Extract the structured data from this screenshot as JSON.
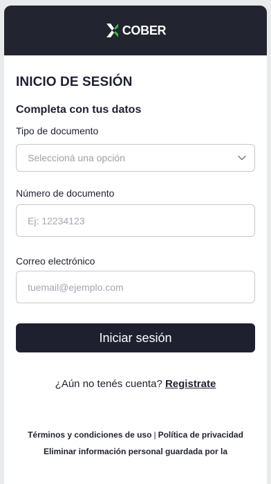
{
  "header": {
    "brand": "COBER"
  },
  "login": {
    "title": "INICIO DE SESIÓN",
    "subtitle": "Completa con tus datos",
    "doc_type_label": "Tipo de documento",
    "doc_type_placeholder": "Seleccioná una opción",
    "doc_number_label": "Número de documento",
    "doc_number_placeholder": "Ej: 12234123",
    "email_label": "Correo electrónico",
    "email_placeholder": "tuemail@ejemplo.com",
    "submit_label": "Iniciar sesión"
  },
  "register": {
    "prompt": "¿Aún no tenés cuenta?",
    "link": "Registrate"
  },
  "footer": {
    "terms": "Términos y condiciones de uso",
    "separator": "|",
    "privacy": "Política de privacidad",
    "delete_info": "Eliminar información personal guardada por la"
  },
  "colors": {
    "header_bg": "#22242f",
    "button_bg": "#1e2030",
    "page_bg": "#e9eaec"
  }
}
